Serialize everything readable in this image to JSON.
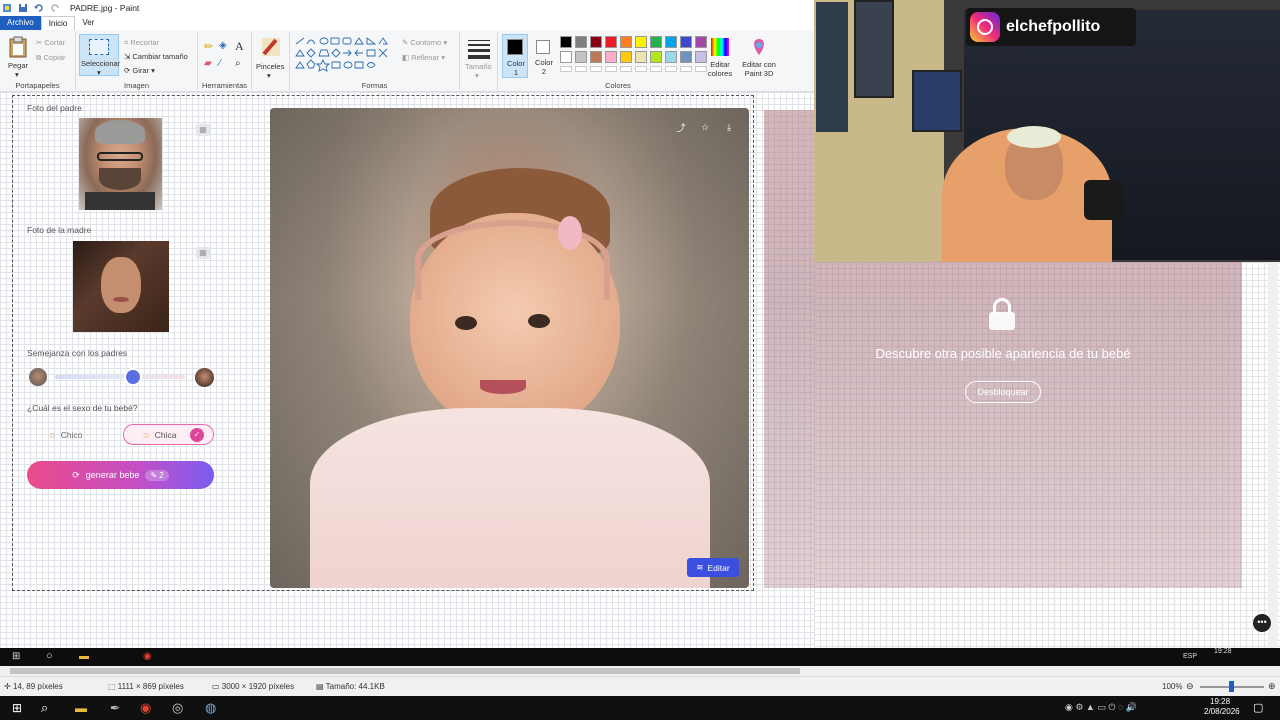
{
  "window": {
    "title": "PADRE.jpg - Paint"
  },
  "menu": {
    "tabs": [
      "Archivo",
      "Inicio",
      "Ver"
    ]
  },
  "ribbon": {
    "portapapeles": {
      "paste": "Pegar",
      "cut": "Cortar",
      "copy": "Copiar",
      "label": "Portapapeles"
    },
    "imagen": {
      "select": "Seleccionar",
      "crop": "Recortar",
      "resize": "Cambiar tamaño",
      "rotate": "Girar",
      "label": "Imagen"
    },
    "herramientas": {
      "label": "Herramientas"
    },
    "pinceles": {
      "label": "Pinceles"
    },
    "formas": {
      "outline": "Contorno",
      "fill": "Rellenar",
      "label": "Formas"
    },
    "tamano": {
      "label": "Tamaño"
    },
    "colores": {
      "color1": "Color 1",
      "color2": "Color 2",
      "edit": "Editar colores",
      "paint3d": "Editar con Paint 3D",
      "label": "Colores",
      "palette": [
        "#000000",
        "#7f7f7f",
        "#880015",
        "#ed1c24",
        "#ff7f27",
        "#fff200",
        "#22b14c",
        "#00a2e8",
        "#3f48cc",
        "#a349a4",
        "#ffffff",
        "#c3c3c3",
        "#b97a57",
        "#ffaec9",
        "#ffc90e",
        "#efe4b0",
        "#b5e61d",
        "#99d9ea",
        "#7092be",
        "#c8bfe7"
      ]
    }
  },
  "app_panel": {
    "father_label": "Foto del padre",
    "mother_label": "Foto de la madre",
    "similarity_label": "Semejanza con los padres",
    "slider_value": 0.6,
    "sex_question": "¿Cuál es el sexo de tu bebé?",
    "option_boy": "Chico",
    "option_girl": "Chica",
    "generate_label": "generar bebe",
    "generate_count": "2",
    "edit_label": "Editar"
  },
  "locked": {
    "title": "Descubre otra posible apariencia de tu bebé",
    "button": "Desbloquear"
  },
  "webcam": {
    "handle": "elchefpollito"
  },
  "status": {
    "cursor": "14, 89 píxeles",
    "selection": "1111 × 869 píxeles",
    "image_size": "3000 × 1920 píxeles",
    "file_size": "Tamaño: 44.1KB",
    "zoom": "100%"
  },
  "tray": {
    "lang": "ESP",
    "time": "19:28",
    "date": "2/08/2026"
  }
}
